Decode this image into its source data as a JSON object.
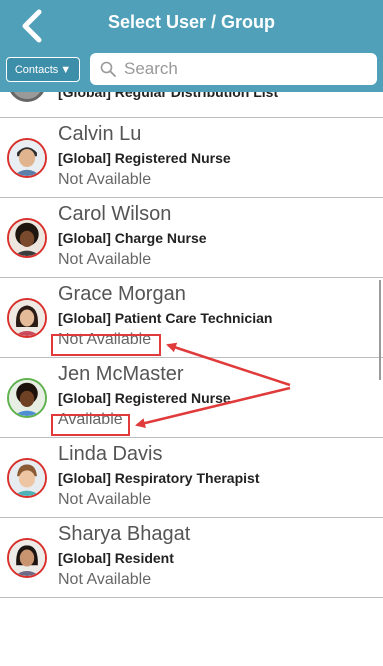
{
  "header": {
    "title": "Select User / Group",
    "contacts_label": "Contacts",
    "search_placeholder": "Search"
  },
  "partial_row": {
    "role": "[Global] Regular Distribution List"
  },
  "contacts": [
    {
      "name": "Calvin Lu",
      "role": "[Global] Registered Nurse",
      "status": "Not Available"
    },
    {
      "name": "Carol Wilson",
      "role": "[Global] Charge Nurse",
      "status": "Not Available"
    },
    {
      "name": "Grace Morgan",
      "role": "[Global] Patient Care Technician",
      "status": "Not Available"
    },
    {
      "name": "Jen McMaster",
      "role": "[Global] Registered Nurse",
      "status": "Available"
    },
    {
      "name": "Linda Davis",
      "role": "[Global] Respiratory Therapist",
      "status": "Not Available"
    },
    {
      "name": "Sharya Bhagat",
      "role": "[Global] Resident",
      "status": "Not Available"
    }
  ],
  "colors": {
    "header": "#4fa0b8",
    "unavailable_ring": "#d9302c",
    "available_ring": "#5fb14d",
    "annotation": "#e03a3a"
  }
}
